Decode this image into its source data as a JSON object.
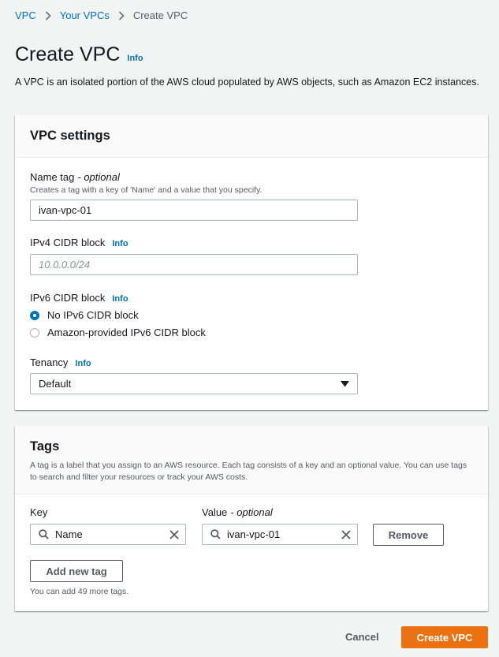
{
  "breadcrumb": {
    "items": [
      {
        "label": "VPC"
      },
      {
        "label": "Your VPCs"
      }
    ],
    "current": "Create VPC"
  },
  "page": {
    "title": "Create VPC",
    "info": "Info",
    "description": "A VPC is an isolated portion of the AWS cloud populated by AWS objects, such as Amazon EC2 instances."
  },
  "vpc_settings": {
    "title": "VPC settings",
    "name_tag": {
      "label": "Name tag",
      "optional": "- optional",
      "hint": "Creates a tag with a key of 'Name' and a value that you specify.",
      "value": "ivan-vpc-01"
    },
    "ipv4": {
      "label": "IPv4 CIDR block",
      "info": "Info",
      "placeholder": "10.0.0.0/24",
      "value": ""
    },
    "ipv6": {
      "label": "IPv6 CIDR block",
      "info": "Info",
      "options": [
        {
          "label": "No IPv6 CIDR block",
          "selected": true
        },
        {
          "label": "Amazon-provided IPv6 CIDR block",
          "selected": false
        }
      ]
    },
    "tenancy": {
      "label": "Tenancy",
      "info": "Info",
      "selected": "Default"
    }
  },
  "tags": {
    "title": "Tags",
    "description": "A tag is a label that you assign to an AWS resource. Each tag consists of a key and an optional value. You can use tags to search and filter your resources or track your AWS costs.",
    "key_label": "Key",
    "value_label": "Value",
    "value_optional": "- optional",
    "rows": [
      {
        "key": "Name",
        "value": "ivan-vpc-01",
        "remove_label": "Remove"
      }
    ],
    "add_label": "Add new tag",
    "remaining_hint": "You can add 49 more tags."
  },
  "footer": {
    "cancel_label": "Cancel",
    "create_label": "Create VPC"
  },
  "colors": {
    "link": "#0073bb",
    "primary": "#ec7211",
    "background": "#f2f3f3"
  }
}
